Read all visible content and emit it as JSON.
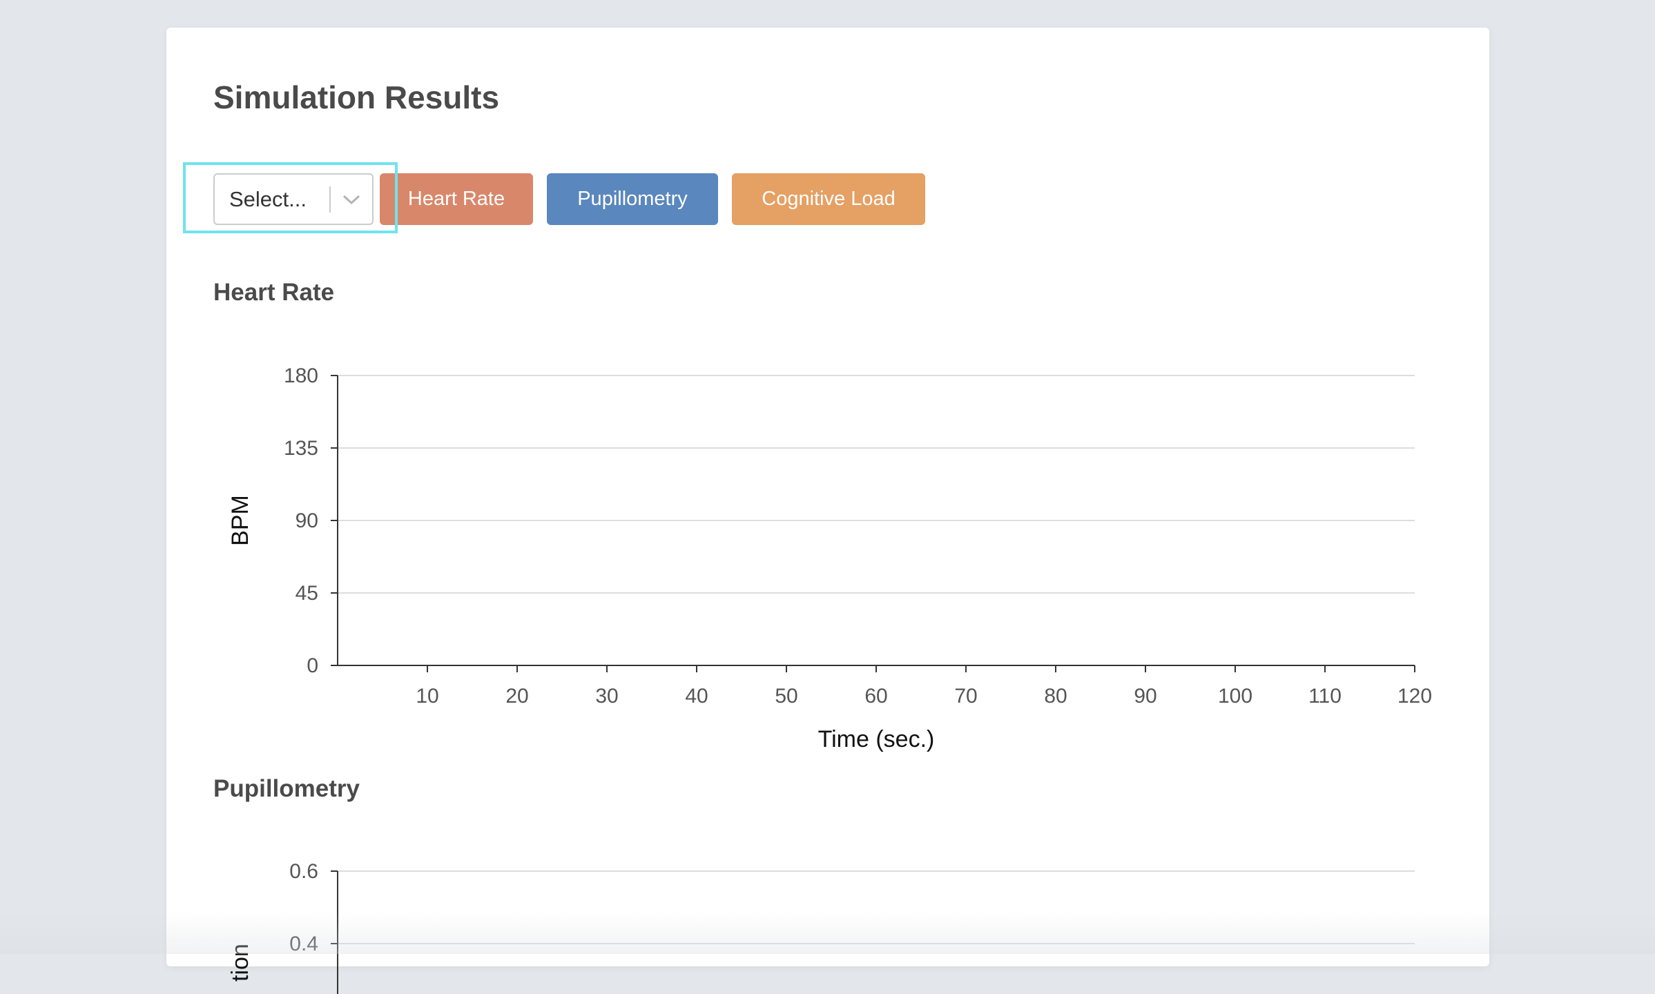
{
  "page": {
    "title": "Simulation Results"
  },
  "toolbar": {
    "select_placeholder": "Select...",
    "buttons": [
      {
        "label": "Heart Rate",
        "color": "#d9876a"
      },
      {
        "label": "Pupillometry",
        "color": "#5a87bd"
      },
      {
        "label": "Cognitive Load",
        "color": "#e5a064"
      }
    ]
  },
  "chart_data": [
    {
      "type": "line",
      "title": "Heart Rate",
      "xlabel": "Time (sec.)",
      "ylabel": "BPM",
      "xlim": [
        0,
        120
      ],
      "ylim": [
        0,
        180
      ],
      "x_ticks": [
        10,
        20,
        30,
        40,
        50,
        60,
        70,
        80,
        90,
        100,
        110,
        120
      ],
      "y_ticks": [
        0,
        45,
        90,
        135,
        180
      ],
      "grid": true,
      "series": []
    },
    {
      "type": "line",
      "title": "Pupillometry",
      "ylabel_partial": "tion",
      "y_ticks_visible": [
        "0.6",
        "0.4"
      ],
      "y_tick_values": [
        0.6,
        0.4
      ],
      "grid": true,
      "series": []
    }
  ]
}
